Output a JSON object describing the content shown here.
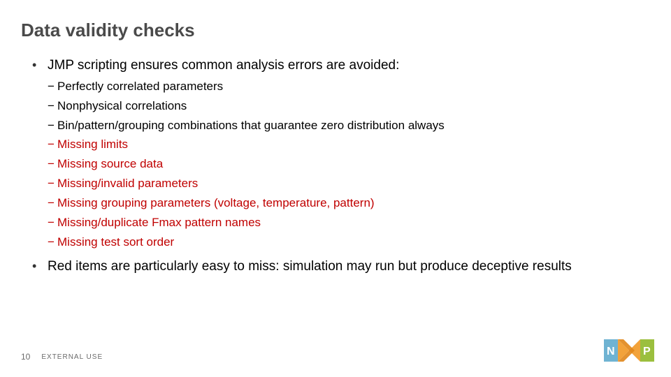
{
  "title": "Data validity checks",
  "bullet1": "JMP scripting ensures common analysis errors are avoided:",
  "sub": {
    "a": "Perfectly correlated parameters",
    "b": "Nonphysical correlations",
    "c": "Bin/pattern/grouping combinations that guarantee zero distribution always",
    "d": "Missing limits",
    "e": "Missing source data",
    "f": "Missing/invalid parameters",
    "g": "Missing grouping parameters (voltage, temperature, pattern)",
    "h": "Missing/duplicate Fmax pattern names",
    "i": "Missing test sort order"
  },
  "bullet2": "Red items are particularly easy to miss: simulation may run but produce deceptive results",
  "footer": {
    "page": "10",
    "classification": "EXTERNAL USE"
  },
  "brand": {
    "accent_blue": "#6fb3d2",
    "accent_orange": "#f2a23a",
    "accent_green": "#9bbf3e"
  }
}
